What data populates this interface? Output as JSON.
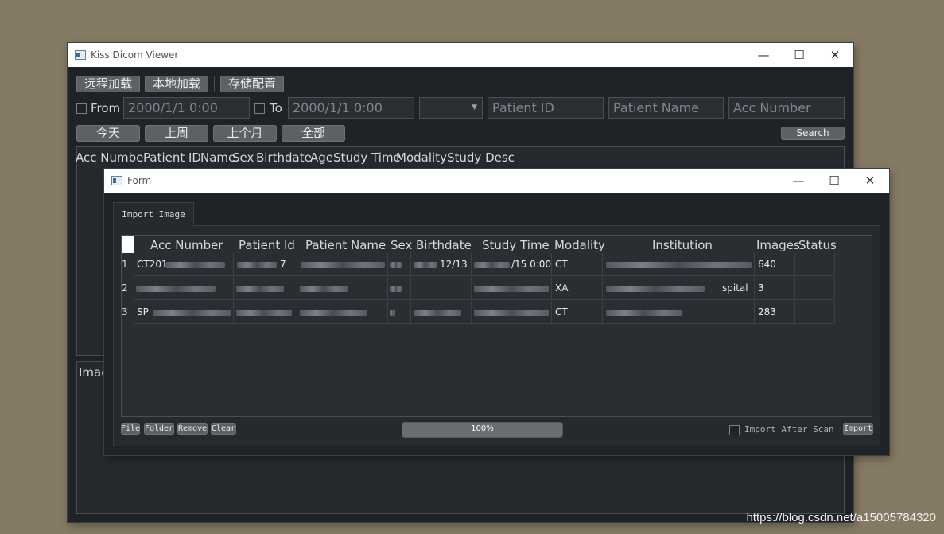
{
  "main_window": {
    "title": "Kiss Dicom Viewer",
    "toolbar": [
      "远程加载",
      "本地加载",
      "存储配置"
    ],
    "from_label": "From",
    "from_value": "2000/1/1 0:00",
    "to_label": "To",
    "to_value": "2000/1/1 0:00",
    "combo_value": "",
    "patient_id_placeholder": "Patient ID",
    "patient_name_placeholder": "Patient Name",
    "acc_number_placeholder": "Acc Number",
    "quick_buttons": [
      "今天",
      "上周",
      "上个月",
      "全部"
    ],
    "search_label": "Search",
    "study_columns": [
      "Acc Numbe",
      "Patient ID",
      "Name",
      "Sex",
      "Birthdate",
      "Age",
      "Study Time",
      "Modality",
      "Study Desc"
    ],
    "image_panel_label": "Imag"
  },
  "form_window": {
    "title": "Form",
    "tab_label": "Import Image",
    "columns": [
      "Acc Number",
      "Patient Id",
      "Patient Name",
      "Sex",
      "Birthdate",
      "Study Time",
      "Modality",
      "Institution",
      "Images",
      "Status"
    ],
    "rows": [
      {
        "num": "1",
        "acc": "CT201",
        "pid": "7",
        "birth": "12/13",
        "study": "/15 0:00",
        "modality": "CT",
        "institution": "",
        "images": "640",
        "status": ""
      },
      {
        "num": "2",
        "acc": "",
        "pid": "",
        "birth": "",
        "study": "",
        "modality": "XA",
        "institution": "spital",
        "images": "3",
        "status": ""
      },
      {
        "num": "3",
        "acc": "SP",
        "pid": "",
        "birth": "",
        "study": "",
        "modality": "CT",
        "institution": "",
        "images": "283",
        "status": ""
      }
    ],
    "buttons": [
      "File",
      "Folder",
      "Remove",
      "Clear"
    ],
    "progress": 100,
    "progress_text": "100%",
    "import_after_scan_label": "Import After Scan",
    "import_label": "Import"
  },
  "watermark": "https://blog.csdn.net/a15005784320"
}
